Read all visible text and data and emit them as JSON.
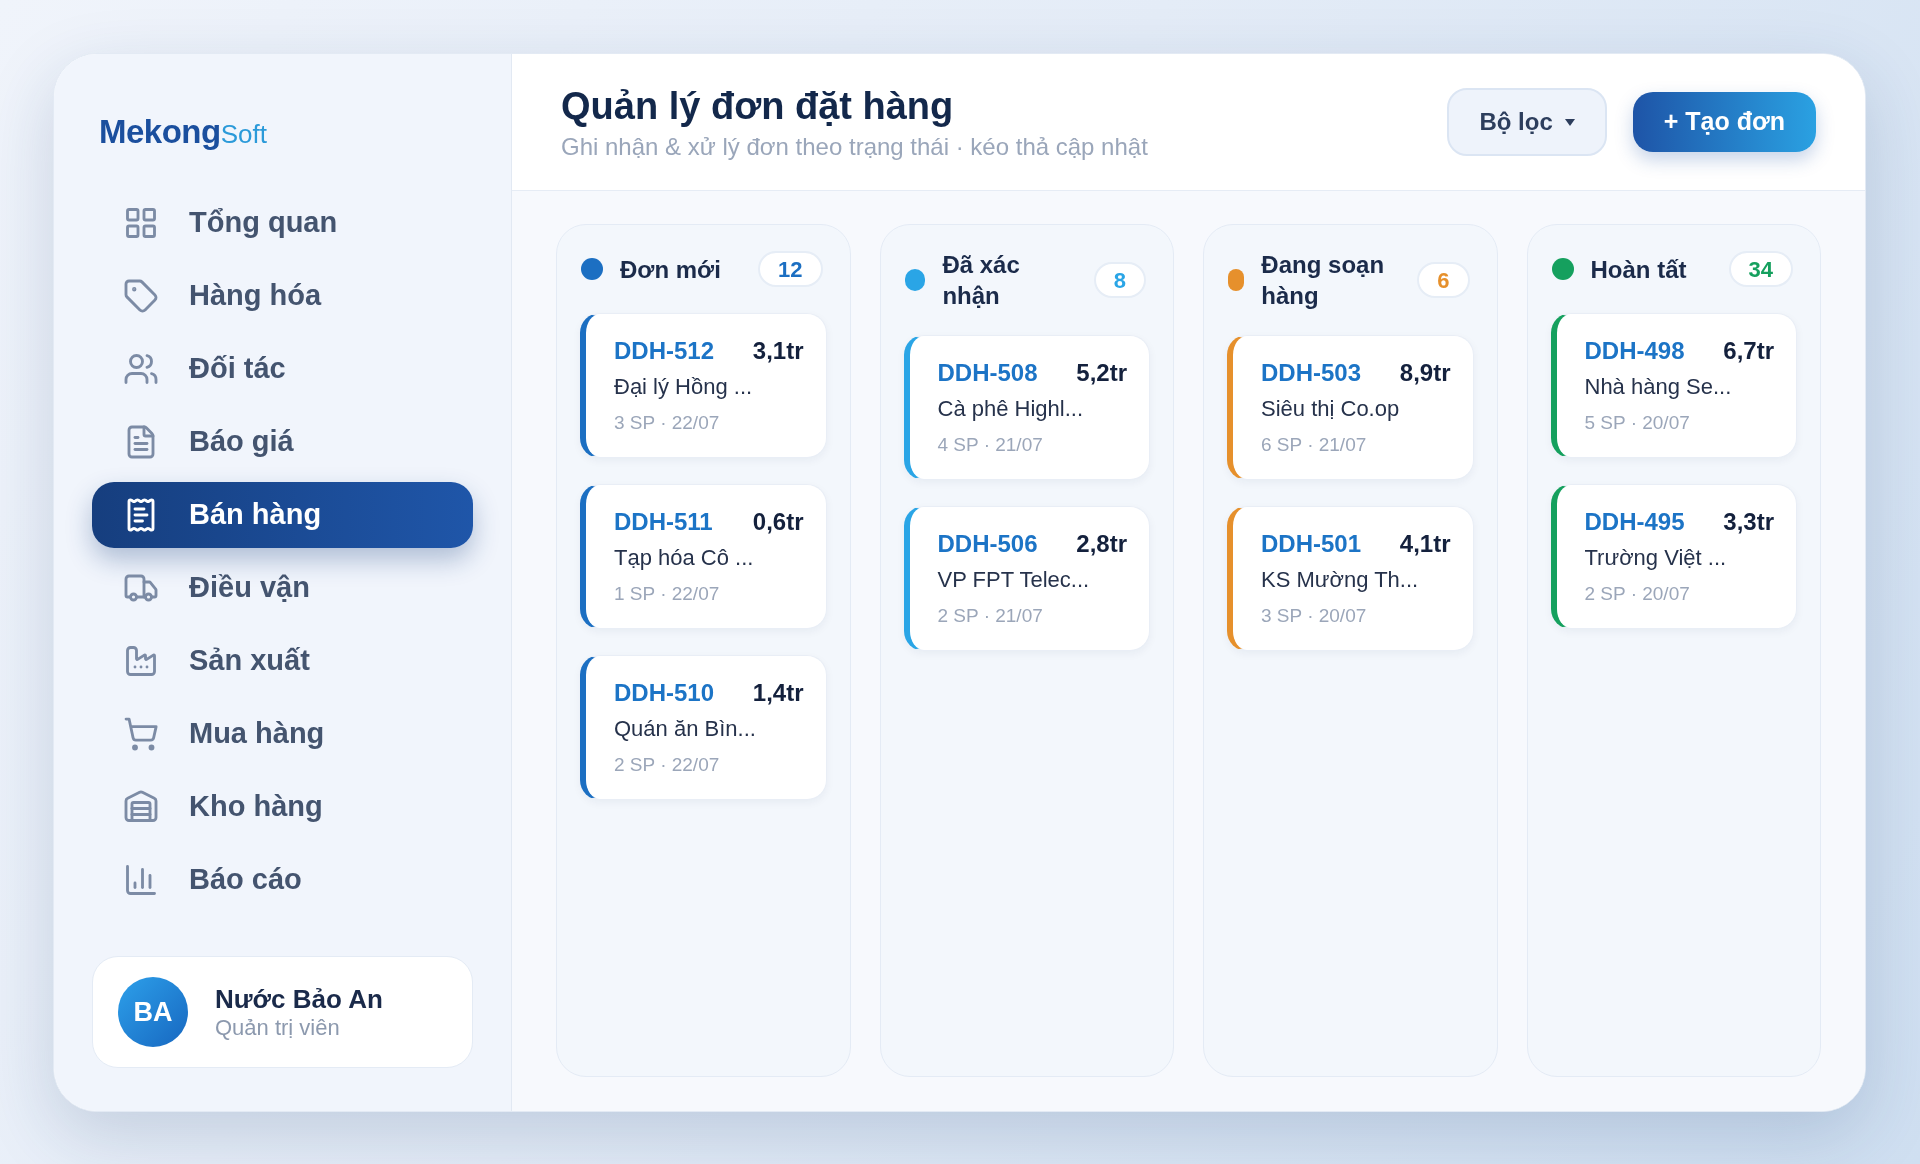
{
  "brand": {
    "name": "Mekong",
    "suffix": "Soft"
  },
  "sidebar": {
    "items": [
      {
        "label": "Tổng quan",
        "selected": false
      },
      {
        "label": "Hàng hóa",
        "selected": false
      },
      {
        "label": "Đối tác",
        "selected": false
      },
      {
        "label": "Báo giá",
        "selected": false
      },
      {
        "label": "Bán hàng",
        "selected": true
      },
      {
        "label": "Điều vận",
        "selected": false
      },
      {
        "label": "Sản xuất",
        "selected": false
      },
      {
        "label": "Mua hàng",
        "selected": false
      },
      {
        "label": "Kho hàng",
        "selected": false
      },
      {
        "label": "Báo cáo",
        "selected": false
      }
    ]
  },
  "user": {
    "initials": "BA",
    "name": "Nước Bảo An",
    "role": "Quản trị viên"
  },
  "header": {
    "title": "Quản lý đơn đặt hàng",
    "subtitle": "Ghi nhận & xử lý đơn theo trạng thái · kéo thả cập nhật",
    "filter_button": "Bộ lọc",
    "create_button": "+ Tạo đơn"
  },
  "columns": [
    {
      "title": "Đơn mới",
      "count": "12",
      "color": "#1c6fc2",
      "cards": [
        {
          "id": "DDH-512",
          "amount": "3,1tr",
          "customer": "Đại lý Hồng ...",
          "meta": "3 SP · 22/07"
        },
        {
          "id": "DDH-511",
          "amount": "0,6tr",
          "customer": "Tạp hóa Cô ...",
          "meta": "1 SP · 22/07"
        },
        {
          "id": "DDH-510",
          "amount": "1,4tr",
          "customer": "Quán ăn Bìn...",
          "meta": "2 SP · 22/07"
        }
      ]
    },
    {
      "title": "Đã xác nhận",
      "count": "8",
      "color": "#2aa5e6",
      "cards": [
        {
          "id": "DDH-508",
          "amount": "5,2tr",
          "customer": "Cà phê Highl...",
          "meta": "4 SP · 21/07"
        },
        {
          "id": "DDH-506",
          "amount": "2,8tr",
          "customer": "VP FPT Telec...",
          "meta": "2 SP · 21/07"
        }
      ]
    },
    {
      "title": "Đang soạn hàng",
      "count": "6",
      "color": "#e6902c",
      "cards": [
        {
          "id": "DDH-503",
          "amount": "8,9tr",
          "customer": "Siêu thị Co.op",
          "meta": "6 SP · 21/07"
        },
        {
          "id": "DDH-501",
          "amount": "4,1tr",
          "customer": "KS Mường Th...",
          "meta": "3 SP · 20/07"
        }
      ]
    },
    {
      "title": "Hoàn tất",
      "count": "34",
      "color": "#15a05e",
      "cards": [
        {
          "id": "DDH-498",
          "amount": "6,7tr",
          "customer": "Nhà hàng Se...",
          "meta": "5 SP · 20/07"
        },
        {
          "id": "DDH-495",
          "amount": "3,3tr",
          "customer": "Trường Việt ...",
          "meta": "2 SP · 20/07"
        }
      ]
    }
  ]
}
